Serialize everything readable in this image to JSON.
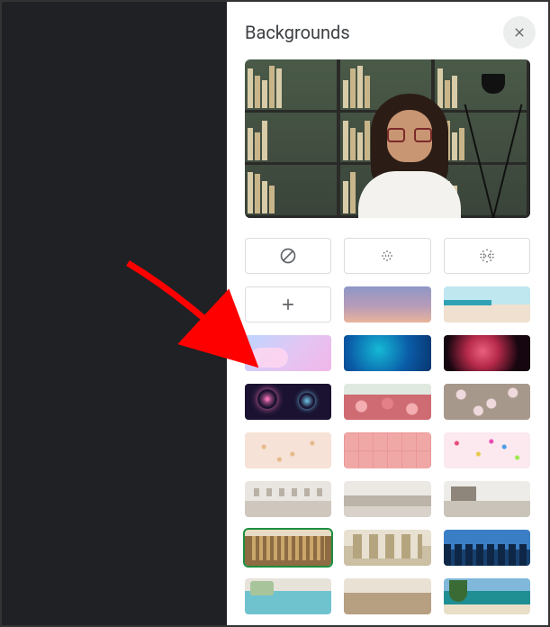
{
  "panel": {
    "title": "Backgrounds"
  },
  "options": {
    "none": "no-background",
    "blur_light": "slightly-blur",
    "blur_strong": "blur",
    "upload": "upload-background"
  },
  "backgrounds": [
    {
      "id": "sunset",
      "label": "Sunset gradient",
      "class": "tn-sunset",
      "selected": false
    },
    {
      "id": "beach",
      "label": "Beach",
      "class": "tn-beach",
      "selected": false
    },
    {
      "id": "pastel",
      "label": "Pastel clouds",
      "class": "tn-pastel",
      "selected": false
    },
    {
      "id": "ocean",
      "label": "Deep ocean",
      "class": "tn-ocean",
      "selected": false
    },
    {
      "id": "nebula",
      "label": "Red nebula",
      "class": "tn-nebula",
      "selected": false
    },
    {
      "id": "fireworks",
      "label": "Fireworks",
      "class": "tn-fireworks",
      "selected": false
    },
    {
      "id": "flowers",
      "label": "Pink flowers",
      "class": "tn-flowers",
      "selected": false
    },
    {
      "id": "blossom",
      "label": "Cherry blossom",
      "class": "tn-blossom",
      "selected": false
    },
    {
      "id": "sparkle",
      "label": "Soft sparkles",
      "class": "tn-sparkle",
      "selected": false
    },
    {
      "id": "pinkpat",
      "label": "Pink tile pattern",
      "class": "tn-pinkpat",
      "selected": false
    },
    {
      "id": "confetti",
      "label": "Confetti",
      "class": "tn-confetti",
      "selected": false
    },
    {
      "id": "room1",
      "label": "Bright gallery room",
      "class": "tn-room1",
      "selected": false
    },
    {
      "id": "room2",
      "label": "Loft with sofa",
      "class": "tn-room2",
      "selected": false
    },
    {
      "id": "room3",
      "label": "Minimal living room",
      "class": "tn-room3",
      "selected": false
    },
    {
      "id": "library",
      "label": "Bookshelf library",
      "class": "tn-library",
      "selected": true
    },
    {
      "id": "kitchen",
      "label": "Wood shelf kitchen",
      "class": "tn-kitchen",
      "selected": false
    },
    {
      "id": "city",
      "label": "City skyline window",
      "class": "tn-city",
      "selected": false
    },
    {
      "id": "pool",
      "label": "Poolside patio",
      "class": "tn-pool",
      "selected": false
    },
    {
      "id": "cafe",
      "label": "Café interior",
      "class": "tn-cafe",
      "selected": false
    },
    {
      "id": "island",
      "label": "Tropical island",
      "class": "tn-island",
      "selected": false
    }
  ],
  "annotation": {
    "arrow_target": "pastel"
  }
}
